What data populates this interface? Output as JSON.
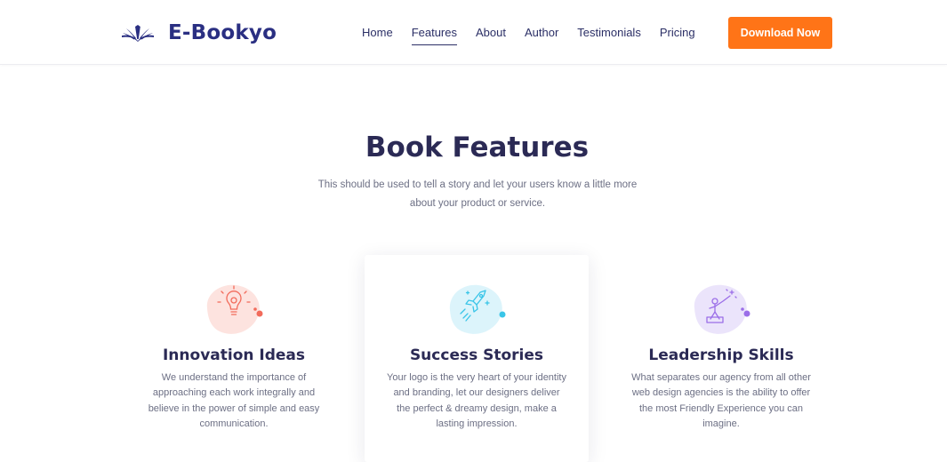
{
  "brand": {
    "name": "E-Bookyo",
    "logo_icon": "open-book-icon",
    "color": "#2a2f82"
  },
  "nav": {
    "items": [
      {
        "label": "Home",
        "active": false
      },
      {
        "label": "Features",
        "active": true
      },
      {
        "label": "About",
        "active": false
      },
      {
        "label": "Author",
        "active": false
      },
      {
        "label": "Testimonials",
        "active": false
      },
      {
        "label": "Pricing",
        "active": false
      }
    ],
    "cta_label": "Download Now",
    "cta_color": "#ff7417"
  },
  "section": {
    "title": "Book Features",
    "subtitle": "This should be used to tell a story and let your users know a little more about your product or service."
  },
  "features": [
    {
      "icon": "lightbulb-icon",
      "accent": "#f26b5b",
      "title": "Innovation Ideas",
      "text": "We understand the importance of approaching each work integrally and believe in the power of simple and easy communication."
    },
    {
      "icon": "rocket-icon",
      "accent": "#39c5e8",
      "title": "Success Stories",
      "text": "Your logo is the very heart of your identity and branding, let our designers deliver the perfect & dreamy design, make a lasting impression."
    },
    {
      "icon": "leader-flag-icon",
      "accent": "#9b6ee8",
      "title": "Leadership Skills",
      "text": "What separates our agency from all other web design agencies is the ability to offer the most Friendly Experience you can imagine."
    }
  ]
}
